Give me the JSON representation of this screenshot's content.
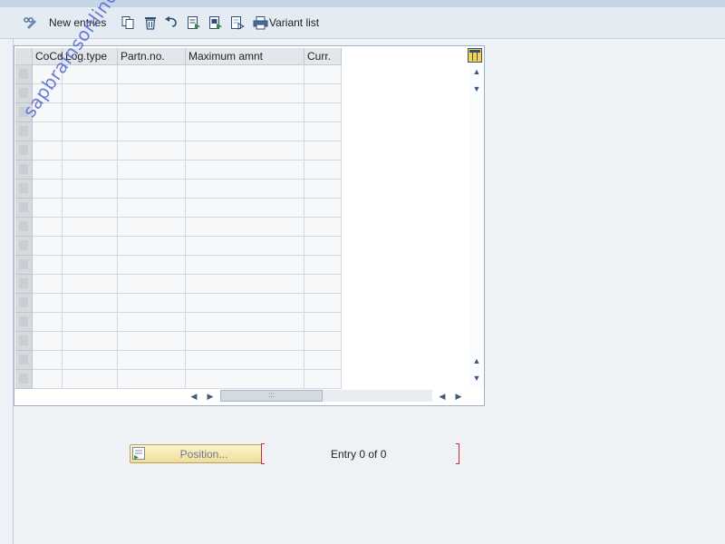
{
  "toolbar": {
    "new_entries_label": "New entries",
    "variant_list_label": "Variant list",
    "icons": [
      "display-change-icon",
      "copy-icon",
      "delete-icon",
      "undo-icon",
      "select-all-icon",
      "select-block-icon",
      "deselect-all-icon",
      "print-icon"
    ]
  },
  "table": {
    "columns": [
      "CoCd",
      "Log.type",
      "Partn.no.",
      "Maximum amnt",
      "Curr."
    ],
    "visible_rows": 17,
    "rows": []
  },
  "watermark": "sapbrainsonline.com",
  "footer": {
    "position_label": "Position...",
    "entry_text": "Entry 0 of 0"
  },
  "colors": {
    "accent_red": "#cc2b2b",
    "watermark": "#5b6fd6",
    "position_button": "#f0dd96"
  }
}
